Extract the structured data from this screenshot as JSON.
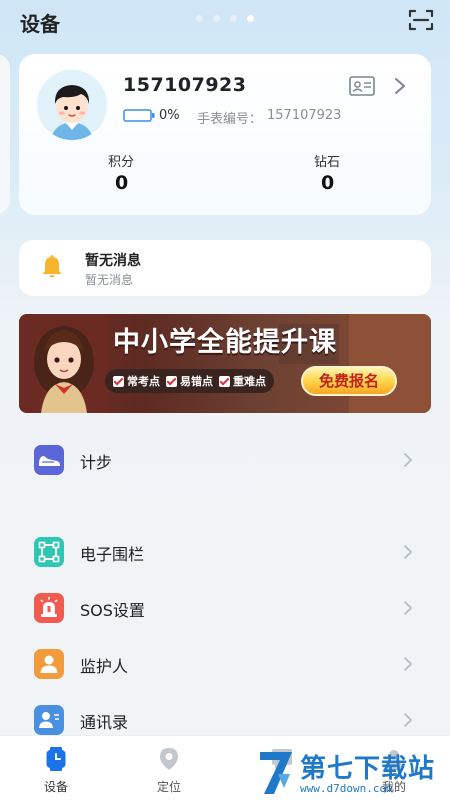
{
  "header": {
    "title": "设备",
    "page_dots": 4,
    "active_dot": 4,
    "scan_icon": "scan-icon"
  },
  "profile": {
    "device_id": "157107923",
    "battery_percent": "0%",
    "battery_level": 0,
    "watch_number_label": "手表编号：",
    "watch_number": "157107923",
    "stats": [
      {
        "label": "积分",
        "value": "0"
      },
      {
        "label": "钻石",
        "value": "0"
      }
    ],
    "card_icon": "id-card-icon",
    "arrow_icon": "chevron-right-icon"
  },
  "messages": {
    "title": "暂无消息",
    "subtitle": "暂无消息",
    "icon": "bell-icon"
  },
  "banner": {
    "title": "中小学全能提升课",
    "tags": [
      "常考点",
      "易错点",
      "重难点"
    ],
    "button": "免费报名"
  },
  "list_group_1": [
    {
      "label": "计步",
      "icon": "shoe-icon",
      "color": "#5b67d8"
    }
  ],
  "list_group_2": [
    {
      "label": "电子围栏",
      "icon": "fence-icon",
      "color": "#2ec7b5"
    },
    {
      "label": "SOS设置",
      "icon": "sos-alarm-icon",
      "color": "#f05a4f"
    },
    {
      "label": "监护人",
      "icon": "guardian-icon",
      "color": "#f39a3c"
    },
    {
      "label": "通讯录",
      "icon": "contacts-icon",
      "color": "#4a90e2"
    }
  ],
  "bottom_nav": [
    {
      "label": "设备",
      "icon": "watch-icon",
      "active": true
    },
    {
      "label": "定位",
      "icon": "location-pin-icon",
      "active": false
    },
    {
      "label": "",
      "icon": "chat-icon",
      "active": false
    },
    {
      "label": "我的",
      "icon": "profile-icon",
      "active": false
    }
  ],
  "watermark": {
    "title": "第七下载站",
    "url": "www.d7down.com"
  },
  "colors": {
    "accent": "#1a73e8",
    "battery_border": "#3a8ee6",
    "banner_button_text": "#c0241e"
  }
}
